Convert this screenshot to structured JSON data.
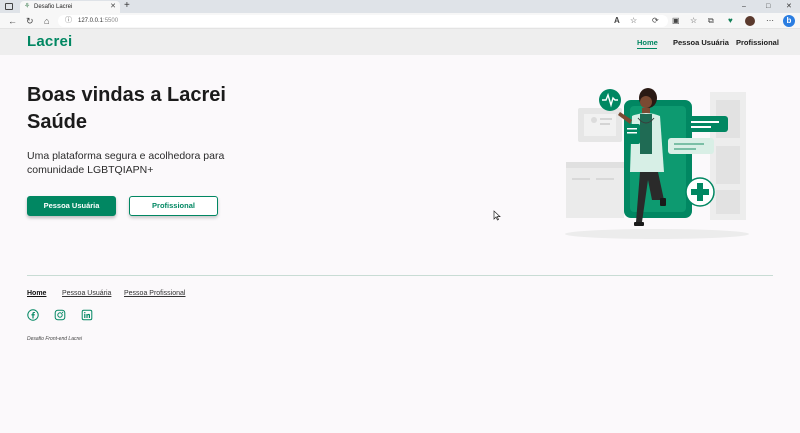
{
  "browser": {
    "tab_title": "Desafio Lacrei",
    "tab_close": "✕",
    "new_tab": "+",
    "url_host": "127.0.0.1",
    "url_port": ":5500",
    "controls": {
      "minimize": "–",
      "maximize": "□",
      "close": "✕"
    },
    "nav": {
      "back": "←",
      "refresh": "↻",
      "home": "⌂"
    },
    "toolbar": {
      "read_aloud": "A",
      "favorite": "☆",
      "extensions": "⟳",
      "split": "▣",
      "favorites": "☆",
      "collections": "⧉",
      "browser_essentials": "♥",
      "more": "⋯"
    },
    "bing": "b"
  },
  "header": {
    "logo": "Lacrei",
    "nav": [
      {
        "label": "Home",
        "active": true
      },
      {
        "label": "Pessoa Usuária"
      },
      {
        "label": "Profissional"
      }
    ]
  },
  "hero": {
    "title": "Boas vindas a Lacrei Saúde",
    "subtitle": "Uma plataforma segura e acolhedora para comunidade LGBTQIAPN+",
    "primary_button": "Pessoa Usuária",
    "secondary_button": "Profissional"
  },
  "footer": {
    "nav": [
      {
        "label": "Home"
      },
      {
        "label": "Pessoa Usuária"
      },
      {
        "label": "Pessoa Profissional"
      }
    ],
    "social": [
      "facebook-icon",
      "instagram-icon",
      "linkedin-icon"
    ],
    "credit": "Desafio Front-end Lacrei"
  },
  "colors": {
    "brand": "#018762",
    "background": "#fbf9fb",
    "header": "#eeeeee"
  }
}
